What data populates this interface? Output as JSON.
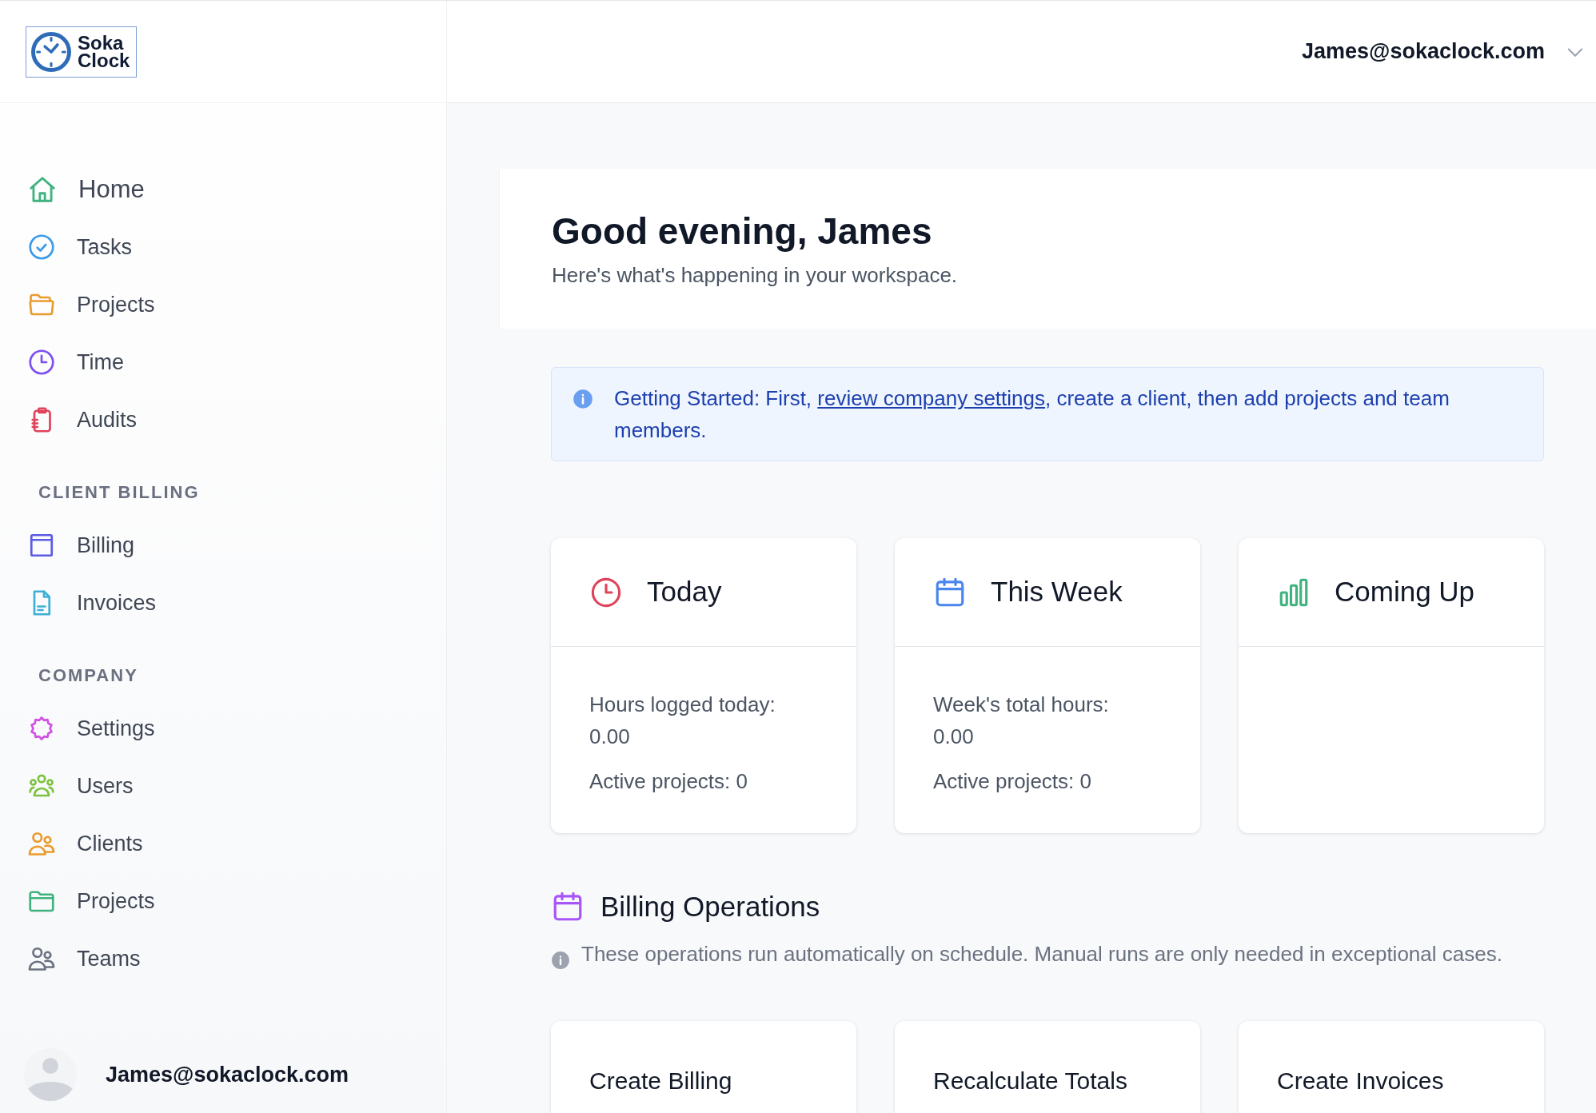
{
  "logo": {
    "line_1": "Soka",
    "line_2": "Clock"
  },
  "header": {
    "user_email": "James@sokaclock.com"
  },
  "sidebar": {
    "main_items": [
      {
        "label": "Home"
      },
      {
        "label": "Tasks"
      },
      {
        "label": "Projects"
      },
      {
        "label": "Time"
      },
      {
        "label": "Audits"
      }
    ],
    "sections": [
      {
        "heading": "CLIENT BILLING",
        "items": [
          {
            "label": "Billing"
          },
          {
            "label": "Invoices"
          }
        ]
      },
      {
        "heading": "COMPANY",
        "items": [
          {
            "label": "Settings"
          },
          {
            "label": "Users"
          },
          {
            "label": "Clients"
          },
          {
            "label": "Projects"
          },
          {
            "label": "Teams"
          }
        ]
      }
    ],
    "user_email": "James@sokaclock.com"
  },
  "greeting": {
    "title": "Good evening, James",
    "subtitle": "Here's what's happening in your workspace."
  },
  "alert": {
    "text_before": "Getting Started: First, ",
    "link": "review company settings",
    "text_after": ", create a client, then add projects and team members."
  },
  "summary_cards": [
    {
      "title": "Today",
      "lines": [
        "Hours logged today: 0.00",
        "Active projects: 0"
      ]
    },
    {
      "title": "This Week",
      "lines": [
        "Week's total hours: 0.00",
        "Active projects: 0"
      ]
    },
    {
      "title": "Coming Up"
    }
  ],
  "billing_operations": {
    "title": "Billing Operations",
    "note": "These operations run automatically on schedule. Manual runs are only needed in exceptional cases.",
    "operations": [
      {
        "title": "Create Billing"
      },
      {
        "title": "Recalculate Totals"
      },
      {
        "title": "Create Invoices"
      }
    ]
  }
}
